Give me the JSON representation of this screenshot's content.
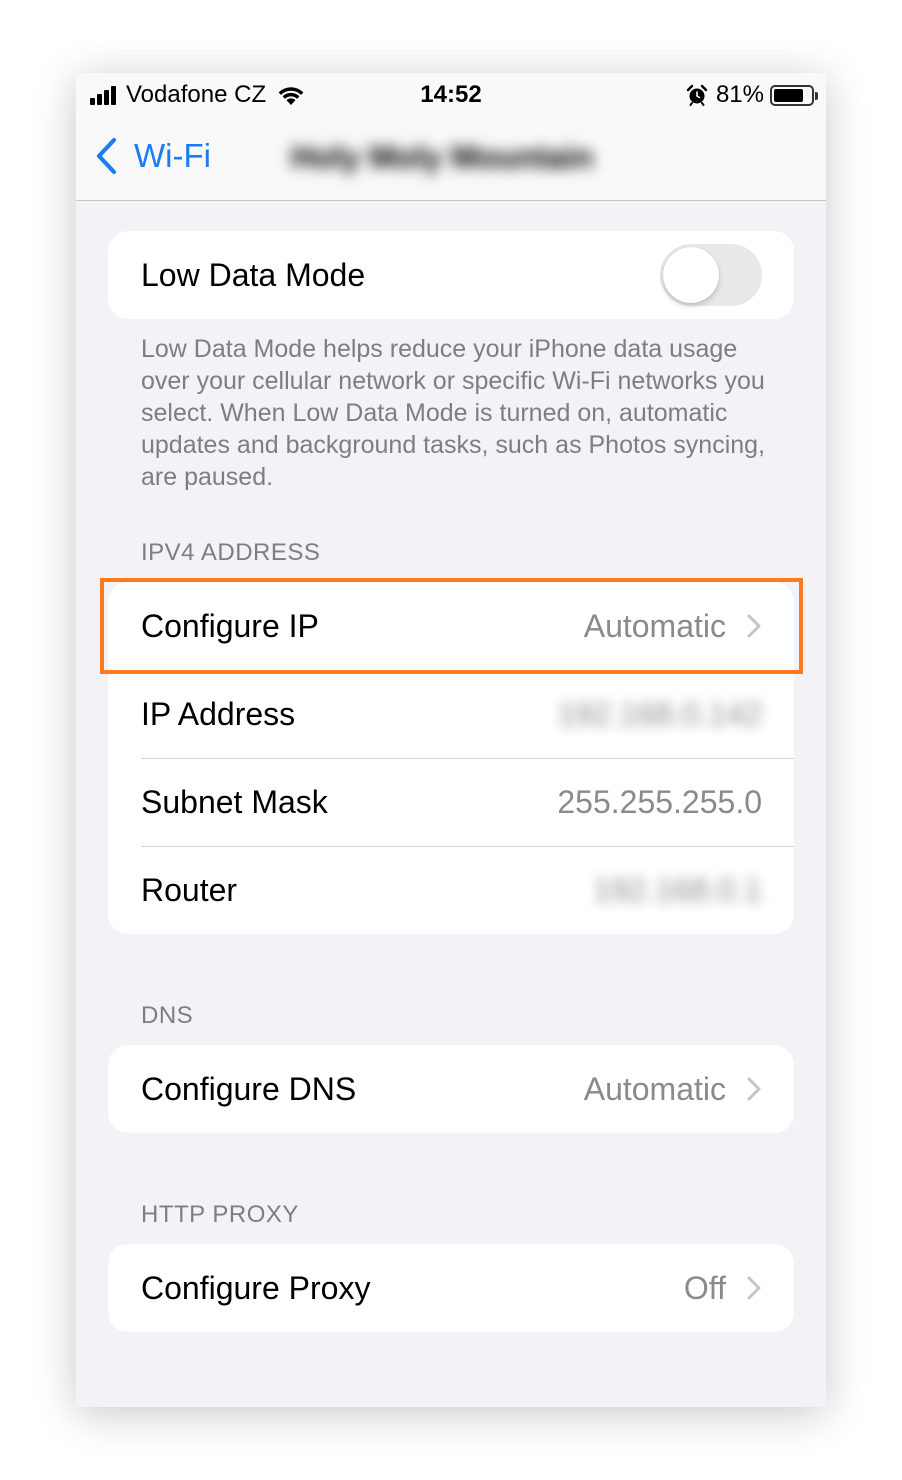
{
  "status_bar": {
    "carrier": "Vodafone CZ",
    "time": "14:52",
    "battery_percent": "81%",
    "battery_level": 0.81
  },
  "nav": {
    "back_label": "Wi-Fi",
    "title": "Holy Moly Mountain"
  },
  "low_data": {
    "label": "Low Data Mode",
    "toggle_on": false,
    "footer": "Low Data Mode helps reduce your iPhone data usage over your cellular network or specific Wi-Fi networks you select. When Low Data Mode is turned on, automatic updates and background tasks, such as Photos syncing, are paused."
  },
  "ipv4": {
    "header": "IPV4 ADDRESS",
    "rows": [
      {
        "label": "Configure IP",
        "value": "Automatic"
      },
      {
        "label": "IP Address",
        "value": "192.168.0.142"
      },
      {
        "label": "Subnet Mask",
        "value": "255.255.255.0"
      },
      {
        "label": "Router",
        "value": "192.168.0.1"
      }
    ]
  },
  "dns": {
    "header": "DNS",
    "label": "Configure DNS",
    "value": "Automatic"
  },
  "proxy": {
    "header": "HTTP PROXY",
    "label": "Configure Proxy",
    "value": "Off"
  },
  "colors": {
    "accent": "#1a7cf5",
    "highlight": "#ff7a1a",
    "background": "#f2f2f7"
  }
}
